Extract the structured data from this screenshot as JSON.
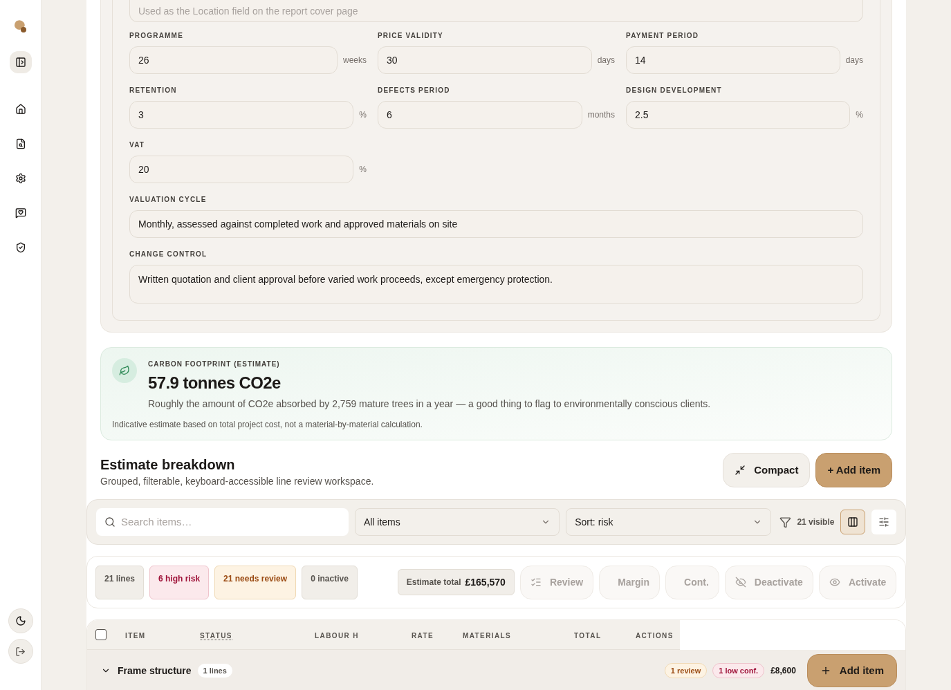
{
  "settings": {
    "location_placeholder": "Used as the Location field on the report cover page",
    "fields": [
      {
        "label": "PROGRAMME",
        "value": "26",
        "unit": "weeks"
      },
      {
        "label": "PRICE VALIDITY",
        "value": "30",
        "unit": "days"
      },
      {
        "label": "PAYMENT PERIOD",
        "value": "14",
        "unit": "days"
      },
      {
        "label": "RETENTION",
        "value": "3",
        "unit": "%"
      },
      {
        "label": "DEFECTS PERIOD",
        "value": "6",
        "unit": "months"
      },
      {
        "label": "DESIGN DEVELOPMENT",
        "value": "2.5",
        "unit": "%"
      },
      {
        "label": "VAT",
        "value": "20",
        "unit": "%"
      }
    ],
    "valuation_cycle": {
      "label": "VALUATION CYCLE",
      "value": "Monthly, assessed against completed work and approved materials on site"
    },
    "change_control": {
      "label": "CHANGE CONTROL",
      "value": "Written quotation and client approval before varied work proceeds, except emergency protection."
    }
  },
  "carbon": {
    "heading": "CARBON FOOTPRINT (ESTIMATE)",
    "value": "57.9 tonnes CO2e",
    "description": "Roughly the amount of CO2e absorbed by 2,759 mature trees in a year — a good thing to flag to environmentally conscious clients.",
    "note": "Indicative estimate based on total project cost, not a material-by-material calculation."
  },
  "breakdown": {
    "title": "Estimate breakdown",
    "subtitle": "Grouped, filterable, keyboard-accessible line review workspace.",
    "compact_button": "Compact",
    "add_button": "+ Add item",
    "toolbar": {
      "search_placeholder": "Search items…",
      "filter": "All items",
      "sort": "Sort: risk",
      "visible": "21 visible",
      "view_buttons": [
        {
          "kind": "columns",
          "selected": true
        },
        {
          "kind": "sliders",
          "selected": false
        }
      ]
    },
    "stats": [
      {
        "label": "21 lines",
        "kind": "neutral"
      },
      {
        "label": "6 high risk",
        "kind": "danger"
      },
      {
        "label": "21 needs review",
        "kind": "warning"
      },
      {
        "label": "0 inactive",
        "kind": "neutral"
      }
    ],
    "estimate_total": {
      "label": "Estimate total",
      "value": "£165,570"
    },
    "actions": [
      {
        "label": "Review",
        "kind": "review"
      },
      {
        "label": "Margin",
        "kind": "plain"
      },
      {
        "label": "Cont.",
        "kind": "plain"
      },
      {
        "label": "Deactivate",
        "kind": "hide"
      },
      {
        "label": "Activate",
        "kind": "show"
      }
    ],
    "table": {
      "select_all_checked": false,
      "columns": [
        {
          "label": "ITEM",
          "has_tooltip": false
        },
        {
          "label": "STATUS",
          "has_tooltip": true
        },
        {
          "label": "LABOUR H",
          "has_tooltip": false
        },
        {
          "label": "RATE",
          "has_tooltip": false
        },
        {
          "label": "MATERIALS",
          "has_tooltip": false
        },
        {
          "label": "TOTAL",
          "has_tooltip": false
        },
        {
          "label": "ACTIONS",
          "has_tooltip": false
        }
      ],
      "group": {
        "name": "Frame structure",
        "count": "1 lines",
        "expanded": true,
        "badges": [
          {
            "label": "1 review",
            "kind": "warning"
          },
          {
            "label": "1 low conf.",
            "kind": "danger"
          }
        ],
        "total": "£8,600",
        "add_button": "Add item"
      }
    }
  }
}
